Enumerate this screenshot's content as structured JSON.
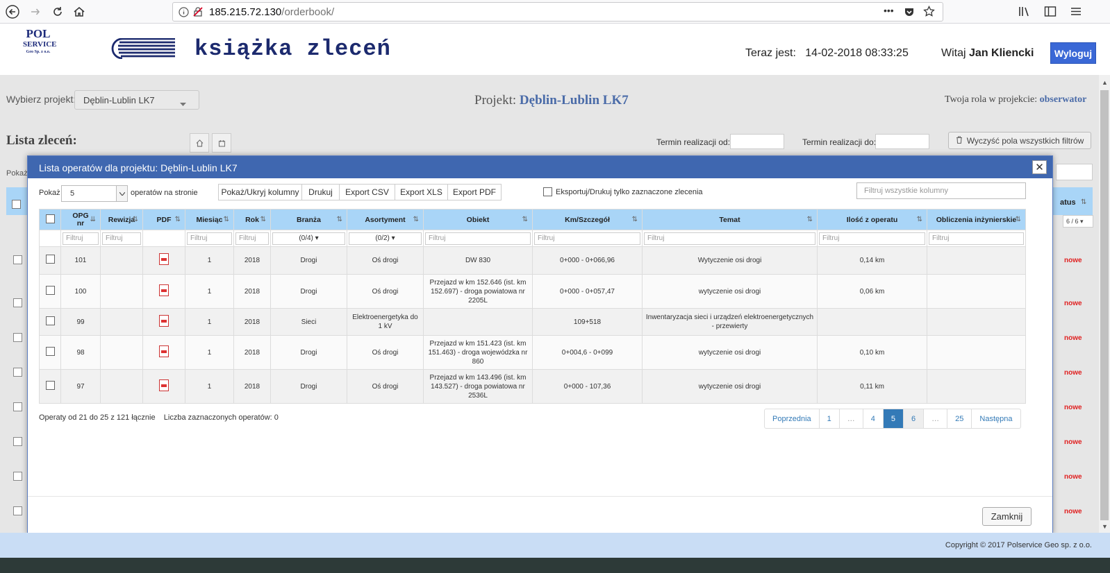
{
  "browser": {
    "url_host": "185.215.72.130",
    "url_path": "/orderbook/",
    "more_icon": "•••"
  },
  "header": {
    "logo_line1": "POL",
    "logo_line2": "SERVICE",
    "logo_line3": "Geo Sp. z o.o.",
    "app_title": "książka zleceń",
    "now_label": "Teraz jest:",
    "now_value": "14-02-2018 08:33:25",
    "welcome_label": "Witaj",
    "user_name": "Jan Kliencki",
    "logout_label": "Wyloguj"
  },
  "project_bar": {
    "select_label": "Wybierz projekt:",
    "selected_project": "Dęblin-Lublin LK7",
    "heading_label": "Projekt:",
    "heading_value": "Dęblin-Lublin LK7",
    "role_label": "Twoja rola w projekcie:",
    "role_value": "obserwator"
  },
  "orders": {
    "title": "Lista zleceń:",
    "date_from_label": "Termin realizacji od:",
    "date_to_label": "Termin realizacji do:",
    "clear_filters_label": "Wyczyść pola wszystkich filtrów",
    "show_label": "Pokaż",
    "status_header": "atus",
    "status_filter": "6 / 6",
    "row_status": "nowe"
  },
  "modal": {
    "title": "Lista operatów dla projektu: Dęblin-Lublin LK7",
    "show_label": "Pokaż",
    "page_size": "5",
    "per_page_label": "operatów na stronie",
    "buttons": [
      "Pokaż/Ukryj kolumny",
      "Drukuj",
      "Export CSV",
      "Export XLS",
      "Export PDF"
    ],
    "only_selected_label": "Eksportuj/Drukuj tylko zaznaczone zlecenia",
    "global_filter_placeholder": "Filtruj wszystkie kolumny",
    "columns": [
      "OPG nr",
      "Rewizja",
      "PDF",
      "Miesiąc",
      "Rok",
      "Branża",
      "Asortyment",
      "Obiekt",
      "Km/Szczegół",
      "Temat",
      "Ilość z operatu",
      "Obliczenia inżynierskie"
    ],
    "filter_placeholder": "Filtruj",
    "branza_filter": "(0/4)",
    "asortyment_filter": "(0/2)",
    "rows": [
      {
        "opg": "101",
        "rewizja": "",
        "miesiac": "1",
        "rok": "2018",
        "branza": "Drogi",
        "asortyment": "Oś drogi",
        "obiekt": "DW 830",
        "km": "0+000 - 0+066,96",
        "temat": "Wytyczenie osi drogi",
        "ilosc": "0,14 km",
        "obliczenia": ""
      },
      {
        "opg": "100",
        "rewizja": "",
        "miesiac": "1",
        "rok": "2018",
        "branza": "Drogi",
        "asortyment": "Oś drogi",
        "obiekt": "Przejazd w km 152.646 (ist. km 152.697) - droga powiatowa nr 2205L",
        "km": "0+000 - 0+057,47",
        "temat": "wytyczenie osi drogi",
        "ilosc": "0,06 km",
        "obliczenia": ""
      },
      {
        "opg": "99",
        "rewizja": "",
        "miesiac": "1",
        "rok": "2018",
        "branza": "Sieci",
        "asortyment": "Elektroenergetyka do 1 kV",
        "obiekt": "",
        "km": "109+518",
        "temat": "Inwentaryzacja sieci i urządzeń elektroenergetycznych - przewierty",
        "ilosc": "",
        "obliczenia": ""
      },
      {
        "opg": "98",
        "rewizja": "",
        "miesiac": "1",
        "rok": "2018",
        "branza": "Drogi",
        "asortyment": "Oś drogi",
        "obiekt": "Przejazd w km 151.423 (ist. km 151.463) - droga wojewódzka nr 860",
        "km": "0+004,6 - 0+099",
        "temat": "wytyczenie osi drogi",
        "ilosc": "0,10 km",
        "obliczenia": ""
      },
      {
        "opg": "97",
        "rewizja": "",
        "miesiac": "1",
        "rok": "2018",
        "branza": "Drogi",
        "asortyment": "Oś drogi",
        "obiekt": "Przejazd w km 143.496 (ist. km 143.527) - droga powiatowa nr 2536L",
        "km": "0+000 - 107,36",
        "temat": "wytyczenie osi drogi",
        "ilosc": "0,11 km",
        "obliczenia": ""
      }
    ],
    "summary": "Operaty od 21 do 25 z 121 łącznie",
    "selected_count": "Liczba zaznaczonych operatów: 0",
    "pagination": [
      "Poprzednia",
      "1",
      "…",
      "4",
      "5",
      "6",
      "…",
      "25",
      "Następna"
    ],
    "active_page": "5",
    "close_label": "Zamknij"
  },
  "footer": {
    "copyright": "Copyright © 2017 Polservice Geo sp. z o.o."
  },
  "colors": {
    "modal_header": "#3f67b0",
    "table_header": "#a9d5f7",
    "accent": "#337ab7",
    "status_new": "#e02020"
  }
}
